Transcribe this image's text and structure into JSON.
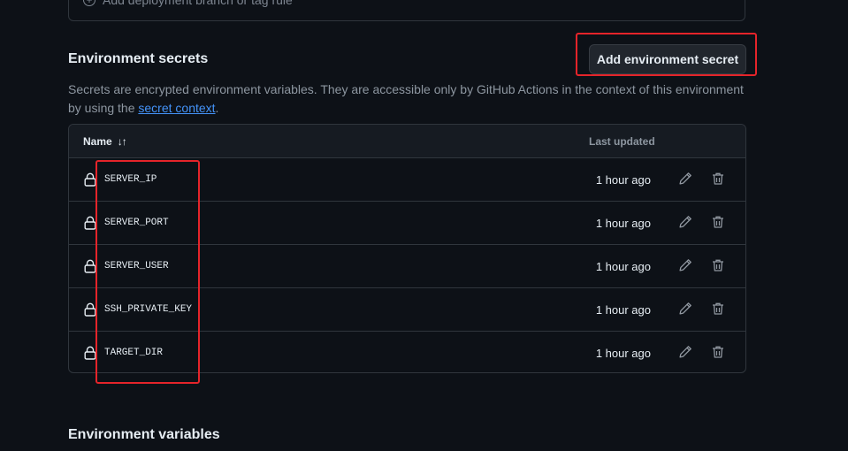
{
  "deployment_rules": {
    "add_rule_label": "Add deployment branch or tag rule"
  },
  "secrets": {
    "title": "Environment secrets",
    "add_button_label": "Add environment secret",
    "description_prefix": "Secrets are encrypted environment variables. They are accessible only by GitHub Actions in the context of this environment by using the ",
    "description_link": "secret context",
    "description_suffix": ".",
    "table": {
      "header_name": "Name",
      "header_sort_icon": "↓↑",
      "header_updated": "Last updated",
      "rows": [
        {
          "name": "SERVER_IP",
          "updated": "1 hour ago"
        },
        {
          "name": "SERVER_PORT",
          "updated": "1 hour ago"
        },
        {
          "name": "SERVER_USER",
          "updated": "1 hour ago"
        },
        {
          "name": "SSH_PRIVATE_KEY",
          "updated": "1 hour ago"
        },
        {
          "name": "TARGET_DIR",
          "updated": "1 hour ago"
        }
      ]
    }
  },
  "variables": {
    "title": "Environment variables"
  },
  "colors": {
    "background": "#0d1117",
    "border": "#30363d",
    "link": "#4493f8",
    "highlight": "#e5242a"
  },
  "icons": {
    "row_icon": "lock-icon",
    "edit": "pencil-icon",
    "delete": "trash-icon",
    "add_rule": "plus-circle-icon"
  }
}
